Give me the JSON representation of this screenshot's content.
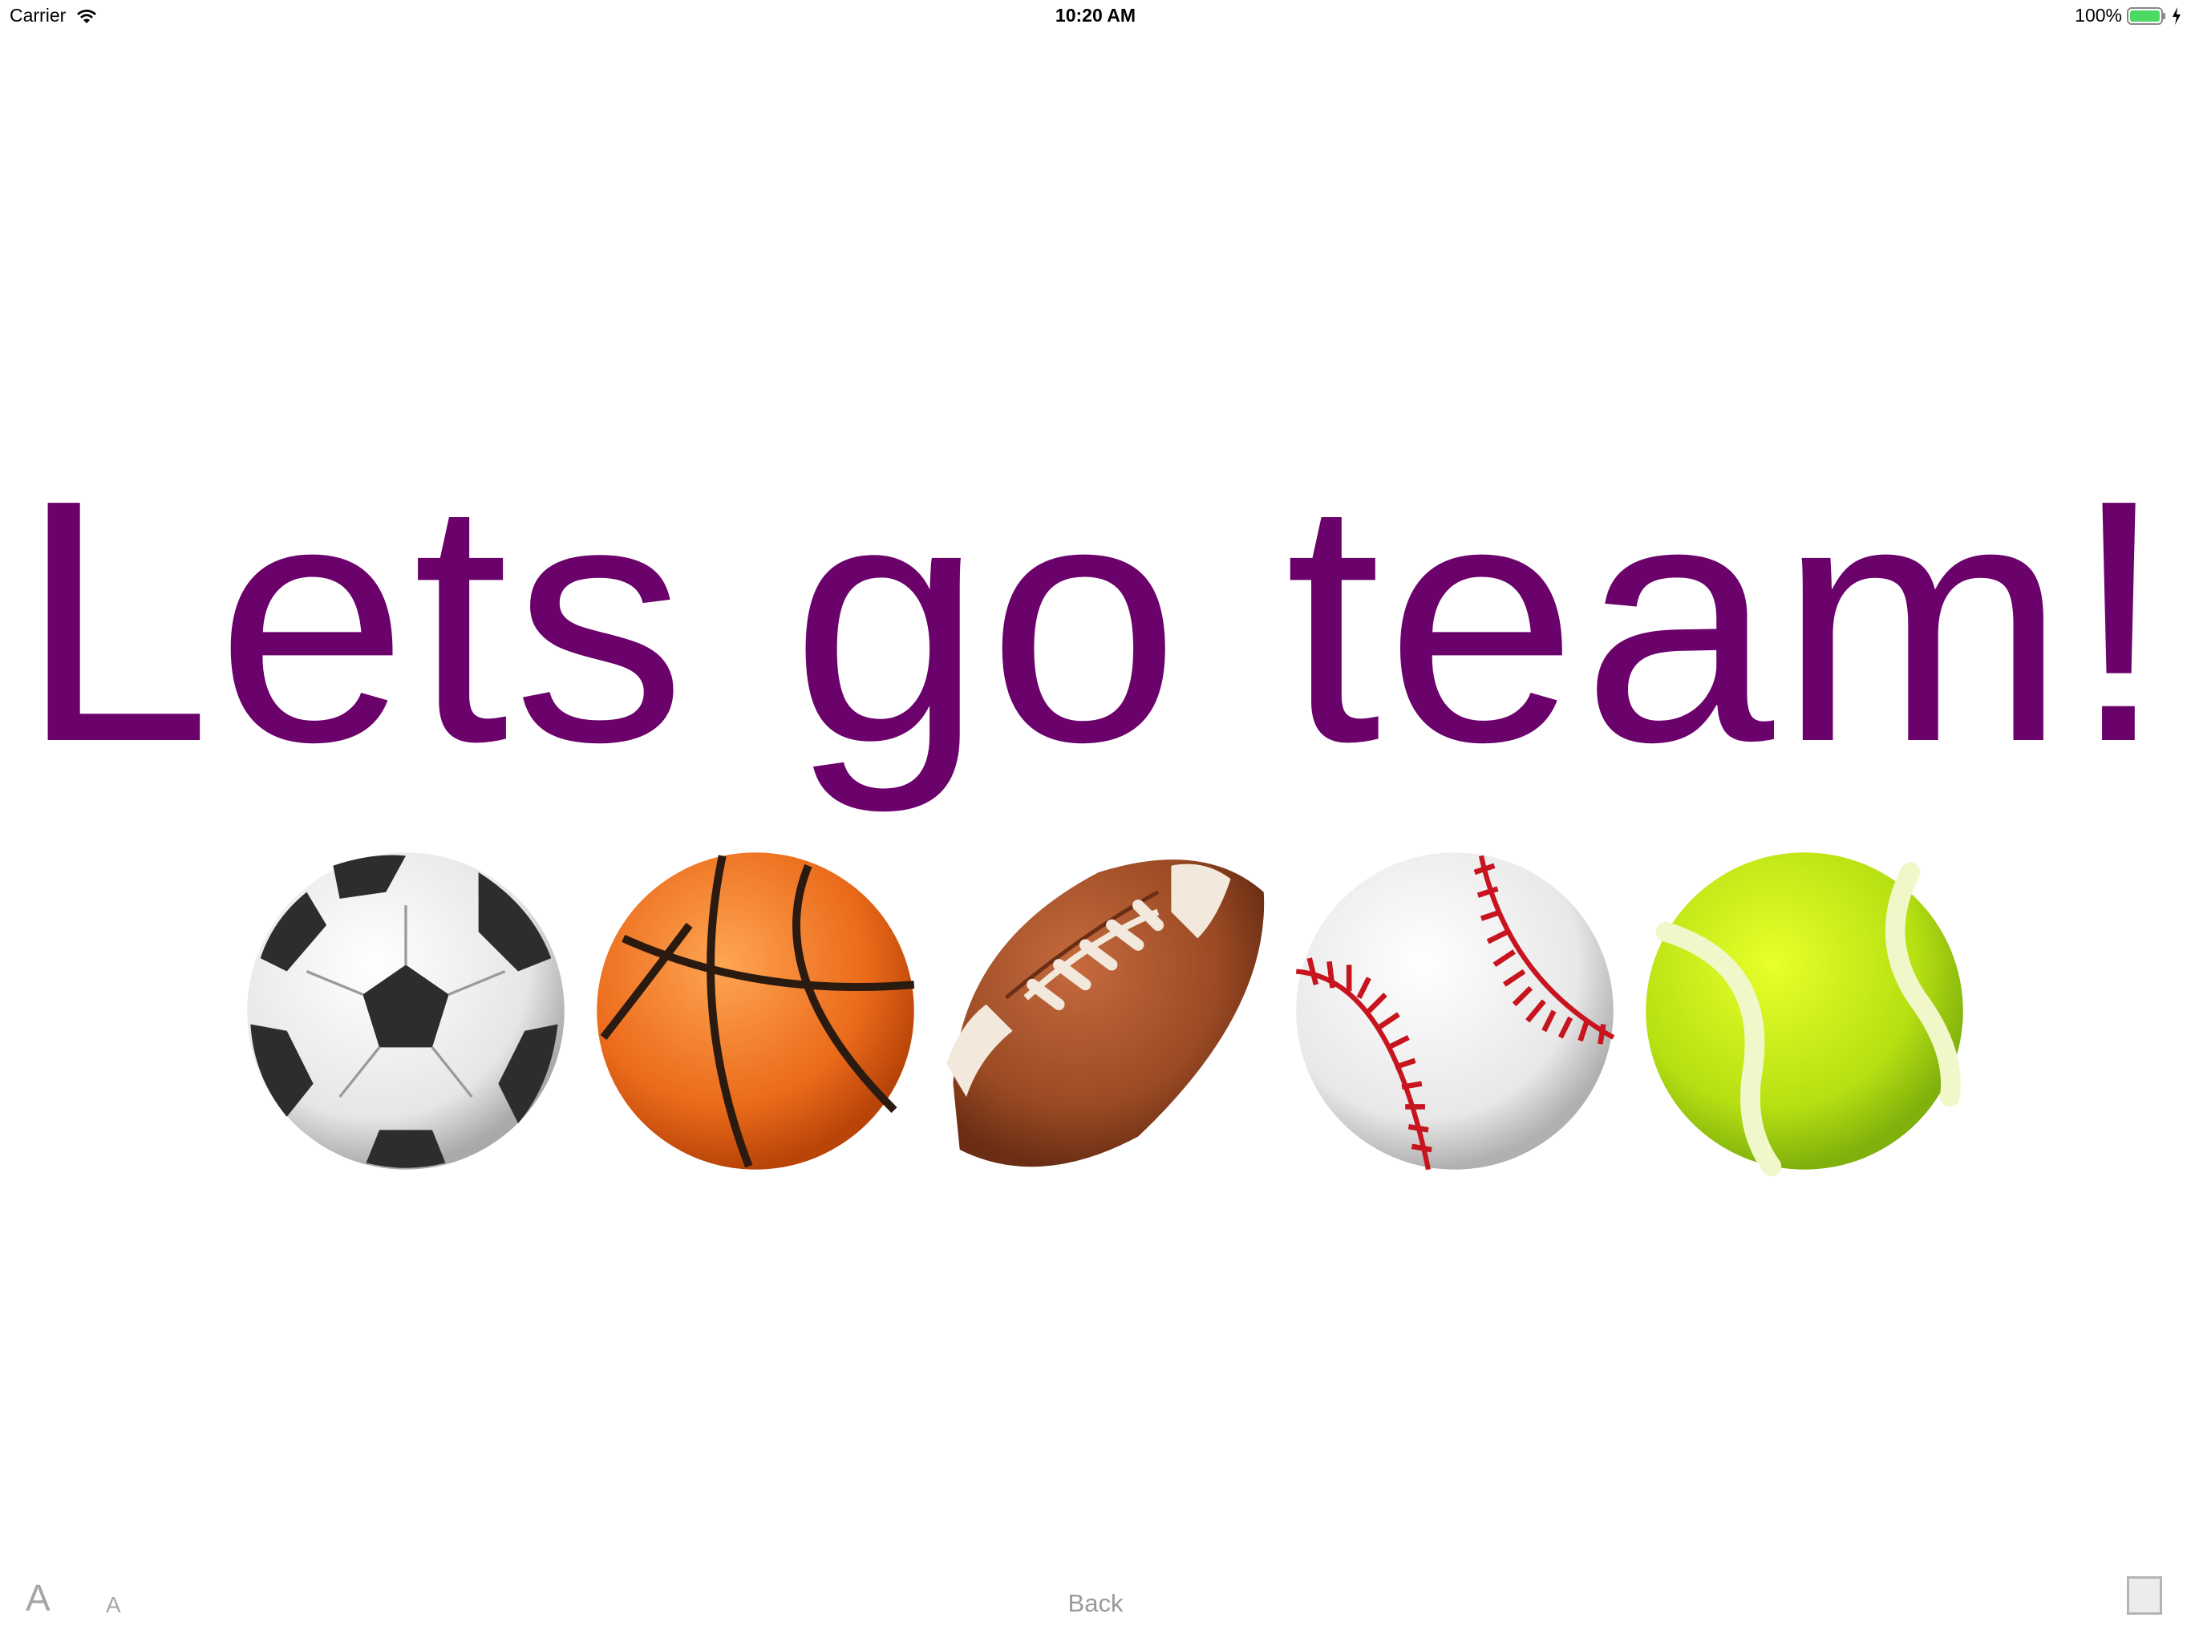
{
  "status_bar": {
    "carrier": "Carrier",
    "time": "10:20 AM",
    "battery": "100%",
    "wifi_icon": "wifi-icon",
    "battery_icon": "battery-icon",
    "charging_icon": "charging-bolt-icon"
  },
  "message": {
    "text": "Lets go team!",
    "color": "#6b016b"
  },
  "balls": [
    {
      "icon": "soccer-ball-icon"
    },
    {
      "icon": "basketball-icon"
    },
    {
      "icon": "american-football-icon"
    },
    {
      "icon": "baseball-icon"
    },
    {
      "icon": "tennis-ball-icon"
    }
  ],
  "toolbar": {
    "font_larger_label": "A",
    "font_smaller_label": "A",
    "back_label": "Back",
    "square_icon": "square-icon"
  },
  "colors": {
    "accent": "#6b016b",
    "toolbar_text": "#9a9a9a",
    "battery_fill": "#4cd964"
  }
}
